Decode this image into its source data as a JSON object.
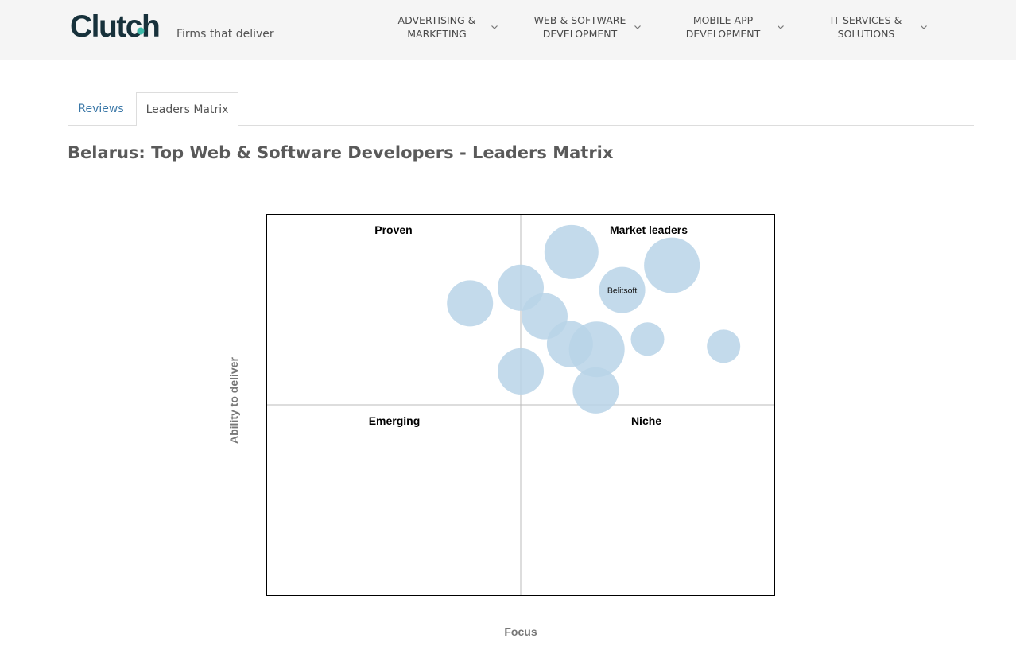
{
  "header": {
    "logo_text": "Clutch",
    "tagline": "Firms that deliver",
    "nav": [
      {
        "line1": "ADVERTISING &",
        "line2": "MARKETING"
      },
      {
        "line1": "WEB & SOFTWARE",
        "line2": "DEVELOPMENT"
      },
      {
        "line1": "MOBILE APP",
        "line2": "DEVELOPMENT"
      },
      {
        "line1": "IT SERVICES &",
        "line2": "SOLUTIONS"
      }
    ]
  },
  "tabs": {
    "reviews": "Reviews",
    "leaders_matrix": "Leaders Matrix"
  },
  "page_title": "Belarus: Top Web & Software Developers - Leaders Matrix",
  "colors": {
    "brand_dark": "#17313b",
    "brand_accent": "#3db9a8",
    "bubble_fill": "#b8d4e8",
    "tab_link": "#3a77a7"
  },
  "chart_data": {
    "type": "scatter",
    "quadrants": {
      "top_left": "Proven",
      "top_right": "Market leaders",
      "bottom_left": "Emerging",
      "bottom_right": "Niche"
    },
    "xlabel": "Focus",
    "ylabel": "Ability to deliver",
    "xlim": [
      0,
      1
    ],
    "ylim": [
      0,
      1
    ],
    "grid": false,
    "points": [
      {
        "label": "",
        "x": 0.6,
        "y": 0.902,
        "r": 34
      },
      {
        "label": "",
        "x": 0.798,
        "y": 0.867,
        "r": 35
      },
      {
        "label": "Belitsoft",
        "x": 0.7,
        "y": 0.802,
        "r": 29
      },
      {
        "label": "",
        "x": 0.5,
        "y": 0.808,
        "r": 29
      },
      {
        "label": "",
        "x": 0.4,
        "y": 0.767,
        "r": 29
      },
      {
        "label": "",
        "x": 0.547,
        "y": 0.733,
        "r": 29
      },
      {
        "label": "",
        "x": 0.75,
        "y": 0.673,
        "r": 21
      },
      {
        "label": "",
        "x": 0.9,
        "y": 0.654,
        "r": 21
      },
      {
        "label": "",
        "x": 0.597,
        "y": 0.66,
        "r": 29
      },
      {
        "label": "",
        "x": 0.65,
        "y": 0.646,
        "r": 35
      },
      {
        "label": "",
        "x": 0.5,
        "y": 0.588,
        "r": 29
      },
      {
        "label": "",
        "x": 0.648,
        "y": 0.538,
        "r": 29
      }
    ]
  }
}
